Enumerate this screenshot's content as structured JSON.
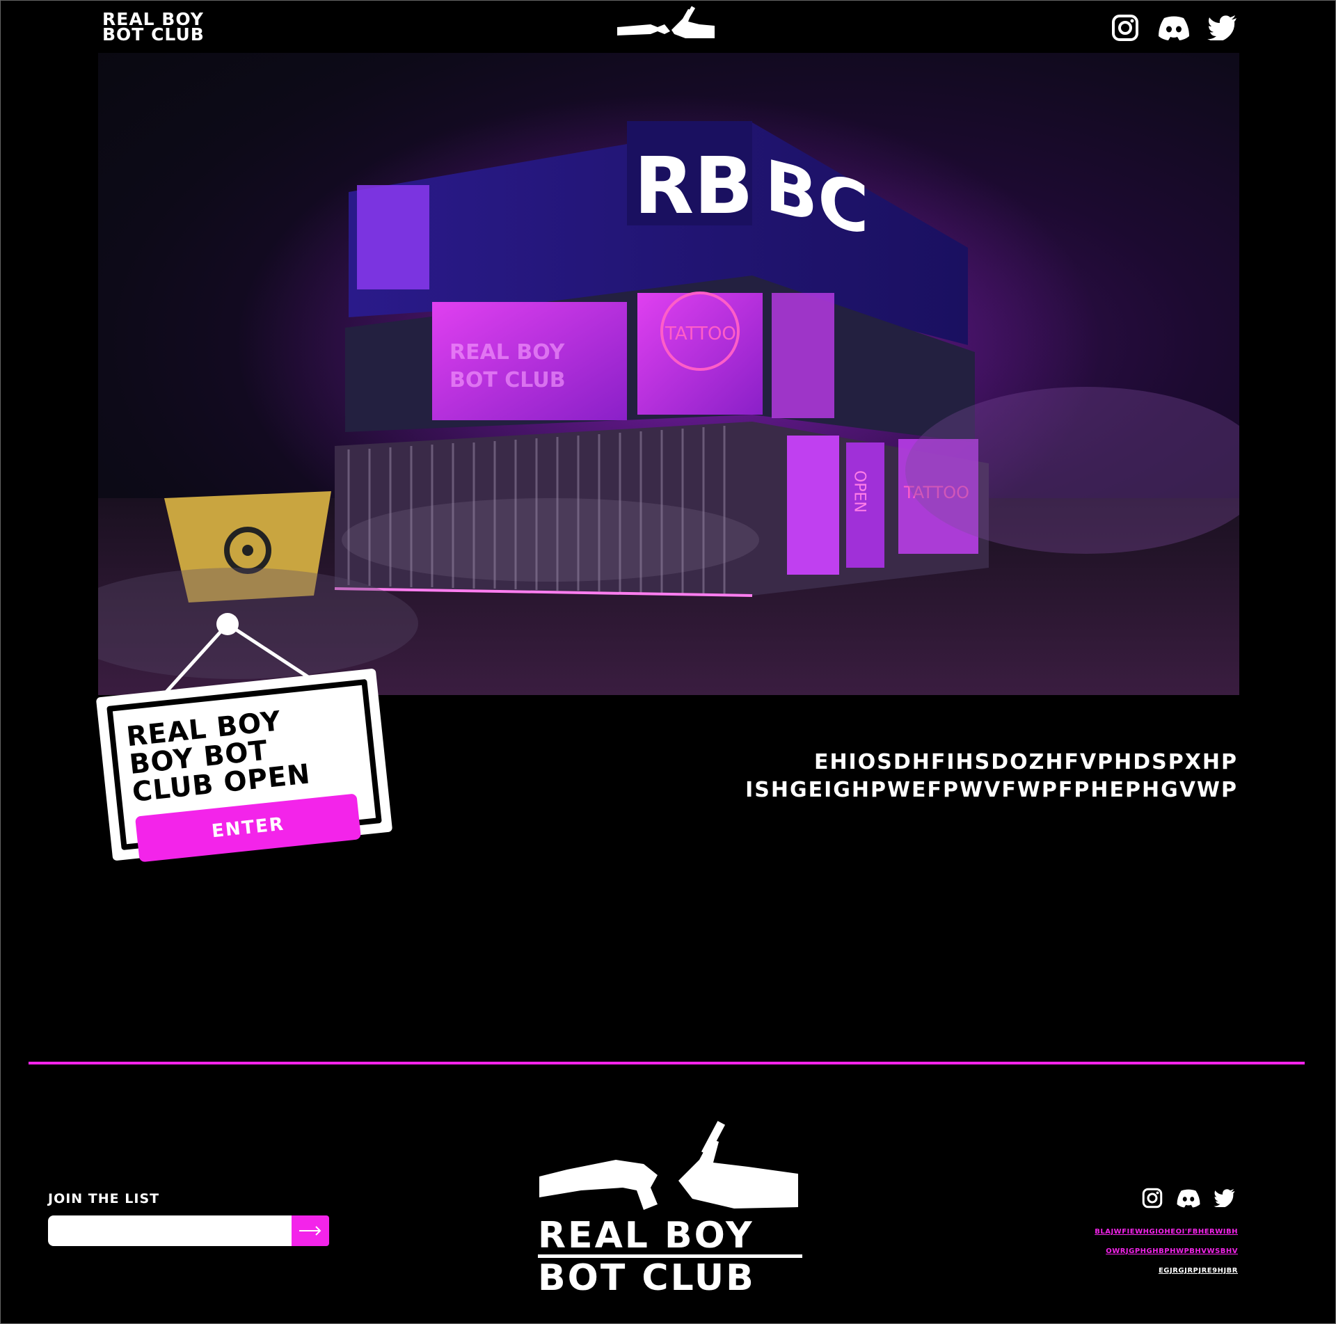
{
  "header": {
    "logo_line1": "REAL BOY",
    "logo_line2": "BOT CLUB",
    "social_icons": [
      "instagram-icon",
      "discord-icon",
      "twitter-icon"
    ]
  },
  "hero": {
    "building_sign": "RBBC",
    "window_text_1": "TATTOO",
    "window_text_2": "TATTOO",
    "door_text": "OPEN",
    "banner_line1": "REAL BOY",
    "banner_line2": "BOT CLUB"
  },
  "sign": {
    "title": "REAL BOY\nBOY BOT\nCLUB OPEN",
    "enter_label": "ENTER"
  },
  "tagline": {
    "line1": "EHIOSDHFIHSDOZHFVPHDSPXHP",
    "line2": "ISHGEIGHPWEFPWVFWPFPHEPHGVWP"
  },
  "footer": {
    "join_label": "JOIN THE LIST",
    "join_placeholder": "",
    "logo_line1": "REAL BOY",
    "logo_line2": "BOT CLUB",
    "links": [
      "BLAJWFIEWHGIOHEOI'FBHERWIBH",
      "OWRJGPHGHBPHWPBHVWSBHV",
      "EGJRGJRPJRE9HJBR"
    ]
  },
  "colors": {
    "accent": "#f324ea",
    "background": "#000000"
  }
}
